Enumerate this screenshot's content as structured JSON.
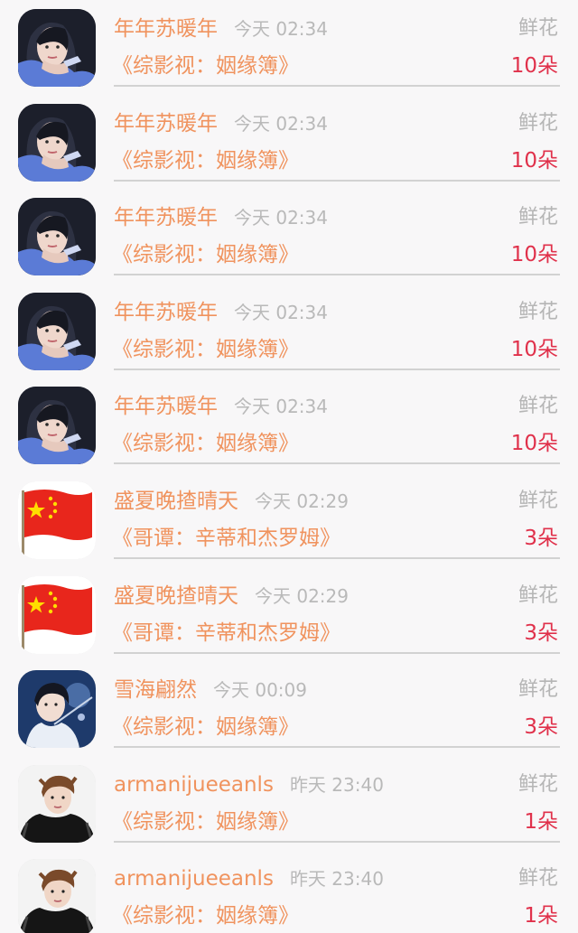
{
  "gift_label": "鲜花",
  "avatar_icons": {
    "woman": "portrait-woman-avatar",
    "flag": "china-flag-avatar",
    "swordsman": "portrait-swordsman-avatar",
    "man": "portrait-man-avatar"
  },
  "colors": {
    "name": "#f0935e",
    "count": "#e0314b",
    "muted": "#b5b5b5",
    "background": "#f8f7f8"
  },
  "records": [
    {
      "avatar": "woman",
      "name": "年年苏暖年",
      "time": "今天 02:34",
      "book": "《综影视：姻缘簿》",
      "count": "10朵"
    },
    {
      "avatar": "woman",
      "name": "年年苏暖年",
      "time": "今天 02:34",
      "book": "《综影视：姻缘簿》",
      "count": "10朵"
    },
    {
      "avatar": "woman",
      "name": "年年苏暖年",
      "time": "今天 02:34",
      "book": "《综影视：姻缘簿》",
      "count": "10朵"
    },
    {
      "avatar": "woman",
      "name": "年年苏暖年",
      "time": "今天 02:34",
      "book": "《综影视：姻缘簿》",
      "count": "10朵"
    },
    {
      "avatar": "woman",
      "name": "年年苏暖年",
      "time": "今天 02:34",
      "book": "《综影视：姻缘簿》",
      "count": "10朵"
    },
    {
      "avatar": "flag",
      "name": "盛夏晚揸晴天",
      "time": "今天 02:29",
      "book": "《哥谭：辛蒂和杰罗姆》",
      "count": "3朵"
    },
    {
      "avatar": "flag",
      "name": "盛夏晚揸晴天",
      "time": "今天 02:29",
      "book": "《哥谭：辛蒂和杰罗姆》",
      "count": "3朵"
    },
    {
      "avatar": "swordsman",
      "name": "雪海翩然",
      "time": "今天 00:09",
      "book": "《综影视：姻缘簿》",
      "count": "3朵"
    },
    {
      "avatar": "man",
      "name": "armanijueeanls",
      "time": "昨天 23:40",
      "book": "《综影视：姻缘簿》",
      "count": "1朵"
    },
    {
      "avatar": "man",
      "name": "armanijueeanls",
      "time": "昨天 23:40",
      "book": "《综影视：姻缘簿》",
      "count": "1朵"
    }
  ]
}
